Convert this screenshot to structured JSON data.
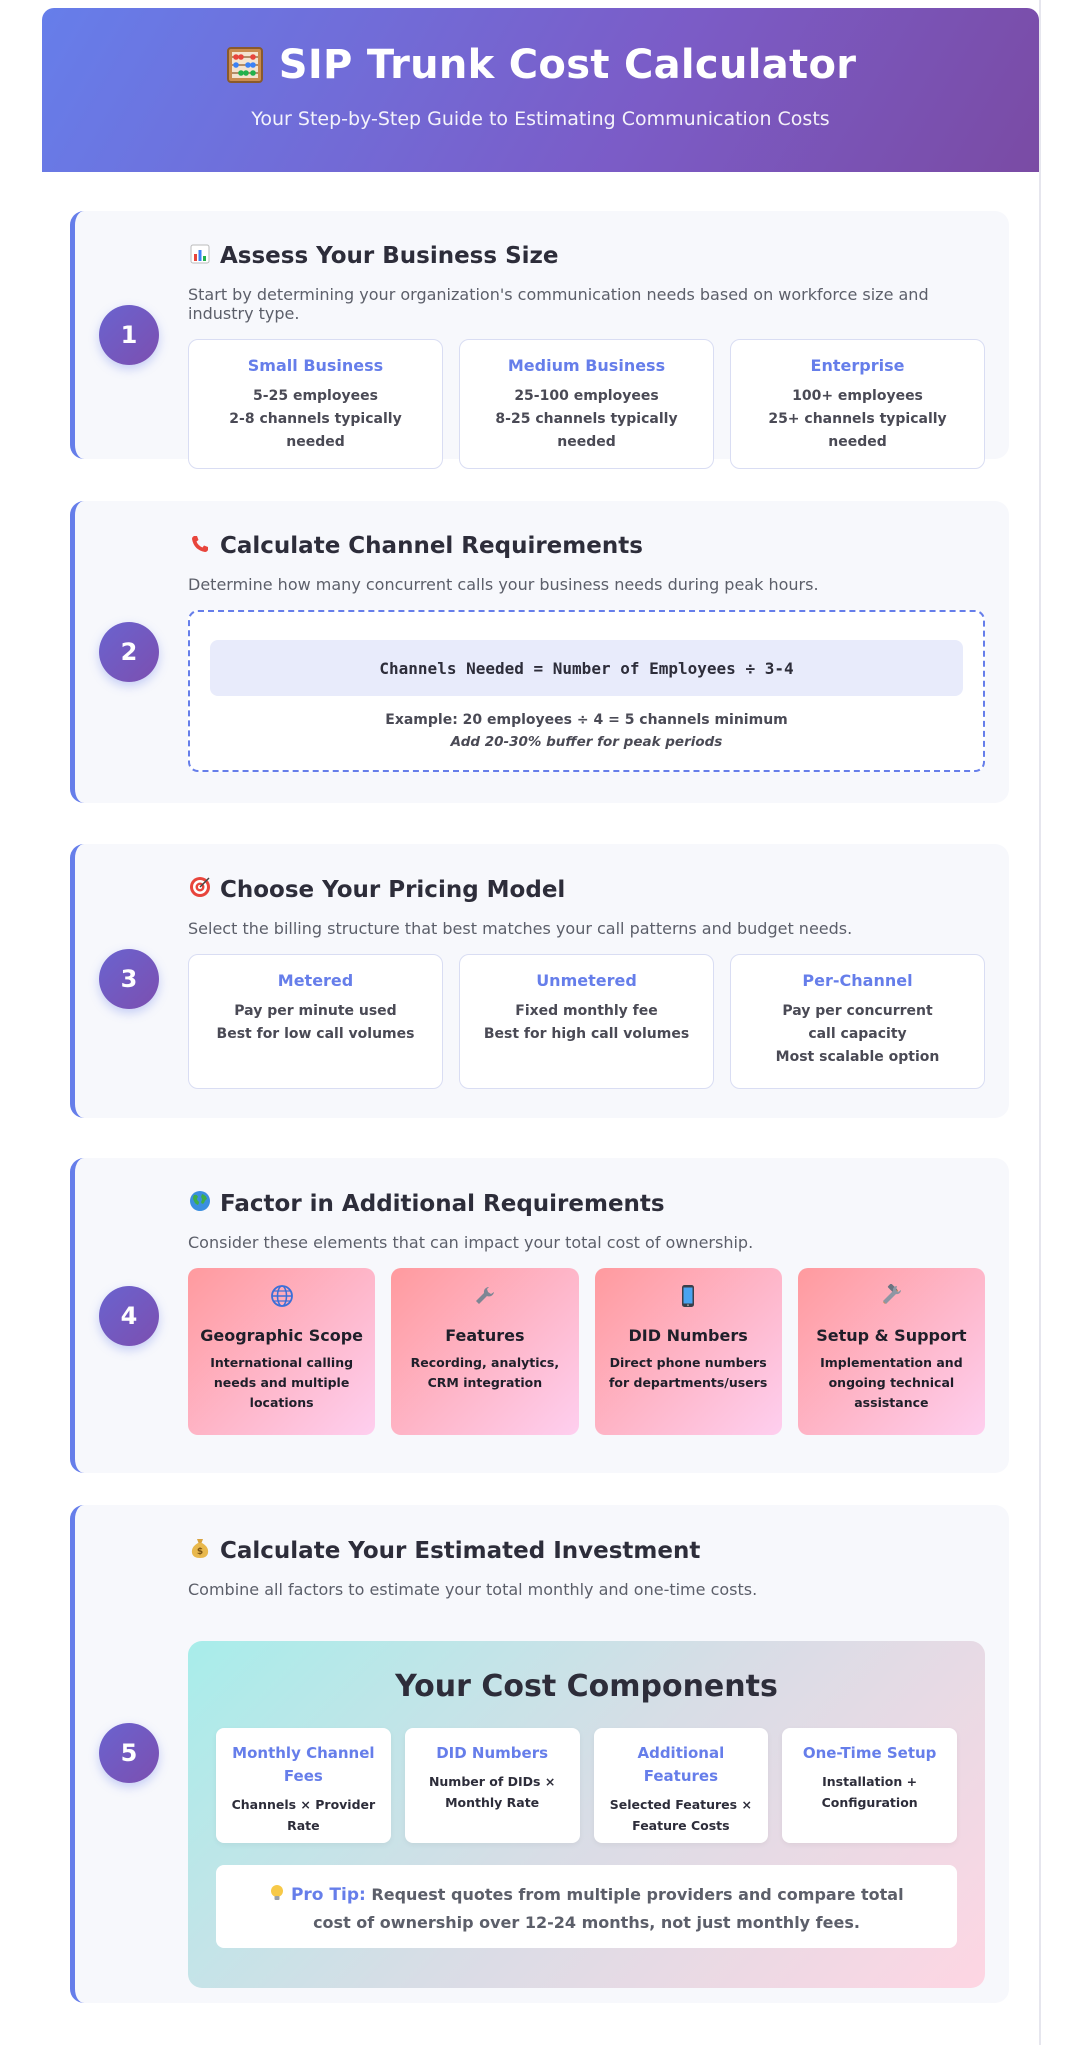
{
  "header": {
    "title": "SIP Trunk Cost Calculator",
    "icon": "abacus-icon",
    "subtitle": "Your Step-by-Step Guide to Estimating Communication Costs"
  },
  "colors": {
    "accent": "#667eea",
    "header_start": "#667eea",
    "header_end": "#7a4ba4"
  },
  "steps": [
    {
      "number": "1",
      "icon": "bar-chart-icon",
      "title": "Assess Your Business Size",
      "description": "Start by determining your organization's communication needs based on workforce size and industry type.",
      "cards": [
        {
          "title": "Small Business",
          "line1": "5-25 employees",
          "line2": "2-8 channels typically needed"
        },
        {
          "title": "Medium Business",
          "line1": "25-100 employees",
          "line2": "8-25 channels typically needed"
        },
        {
          "title": "Enterprise",
          "line1": "100+ employees",
          "line2": "25+ channels typically needed"
        }
      ]
    },
    {
      "number": "2",
      "icon": "telephone-icon",
      "title": "Calculate Channel Requirements",
      "description": "Determine how many concurrent calls your business needs during peak hours.",
      "formula": "Channels Needed = Number of Employees ÷ 3-4",
      "example": "Example: 20 employees ÷ 4 = 5 channels minimum",
      "note": "Add 20-30% buffer for peak periods"
    },
    {
      "number": "3",
      "icon": "target-icon",
      "title": "Choose Your Pricing Model",
      "description": "Select the billing structure that best matches your call patterns and budget needs.",
      "cards": [
        {
          "title": "Metered",
          "line1": "Pay per minute used",
          "line2": "Best for low call volumes"
        },
        {
          "title": "Unmetered",
          "line1": "Fixed monthly fee",
          "line2": "Best for high call volumes"
        },
        {
          "title": "Per-Channel",
          "line1": "Pay per concurrent call capacity",
          "line2": "Most scalable option"
        }
      ]
    },
    {
      "number": "4",
      "icon": "globe-icon",
      "title": "Factor in Additional Requirements",
      "description": "Consider these elements that can impact your total cost of ownership.",
      "cards": [
        {
          "icon": "globe-icon",
          "title": "Geographic Scope",
          "description": "International calling needs and multiple locations"
        },
        {
          "icon": "wrench-icon",
          "title": "Features",
          "description": "Recording, analytics, CRM integration"
        },
        {
          "icon": "mobile-phone-icon",
          "title": "DID Numbers",
          "description": "Direct phone numbers for departments/users"
        },
        {
          "icon": "tools-icon",
          "title": "Setup & Support",
          "description": "Implementation and ongoing technical assistance"
        }
      ]
    },
    {
      "number": "5",
      "icon": "money-bag-icon",
      "title": "Calculate Your Estimated Investment",
      "description": "Combine all factors to estimate your total monthly and one-time costs.",
      "panel_title": "Your Cost Components",
      "cards": [
        {
          "title": "Monthly Channel Fees",
          "description": "Channels × Provider Rate"
        },
        {
          "title": "DID Numbers",
          "description": "Number of DIDs × Monthly Rate"
        },
        {
          "title": "Additional Features",
          "description": "Selected Features × Feature Costs"
        },
        {
          "title": "One-Time Setup",
          "description": "Installation + Configuration"
        }
      ],
      "pro_tip": {
        "icon": "lightbulb-icon",
        "label": "Pro Tip:",
        "text": "Request quotes from multiple providers and compare total cost of ownership over 12-24 months, not just monthly fees."
      }
    }
  ]
}
